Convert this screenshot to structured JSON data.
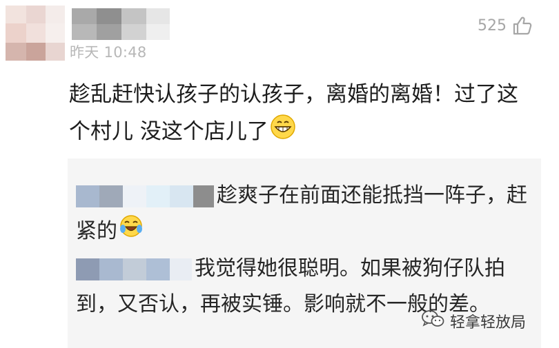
{
  "comment": {
    "timestamp": "昨天 10:48",
    "likes": "525",
    "text": "趁乱赶快认孩子的认孩子，离婚的离婚！过了这个村儿 没这个店儿了"
  },
  "replies": [
    {
      "text": "趁爽子在前面还能抵挡一阵子，赶紧的"
    },
    {
      "text": "我觉得她很聪明。如果被狗仔队拍到，又否认，再被实锤。影响就不一般的差。"
    }
  ],
  "watermark": {
    "text": "轻拿轻放局"
  },
  "icons": {
    "like": "thumbs-up-icon",
    "grin_emoji": "grinning-face-icon",
    "laugh_cry_emoji": "tears-of-joy-icon",
    "wechat": "wechat-icon"
  },
  "colors": {
    "timestamp": "#b7b7b7",
    "like_count": "#a6a6a6",
    "reply_background": "#f5f5f5"
  }
}
